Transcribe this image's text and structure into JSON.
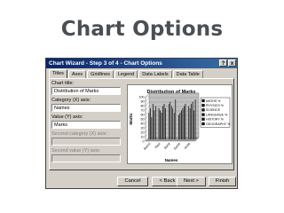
{
  "slide": {
    "title": "Chart Options"
  },
  "dialog": {
    "title": "Chart Wizard - Step 3 of 4 - Chart Options",
    "help_label": "?",
    "close_label": "x",
    "tabs": [
      "Titles",
      "Axes",
      "Gridlines",
      "Legend",
      "Data Labels",
      "Data Table"
    ],
    "active_tab": "Titles",
    "fields": {
      "chart_title": {
        "label": "Chart title:",
        "value": "Distribution of Marks"
      },
      "category_x": {
        "label": "Category (X) axis:",
        "value": "Names"
      },
      "value_y": {
        "label": "Value (Y) axis:",
        "value": "Marks"
      },
      "second_category_x": {
        "label": "Second category (X) axis:",
        "value": ""
      },
      "second_value_y": {
        "label": "Second value (Y) axis:",
        "value": ""
      }
    },
    "buttons": {
      "cancel": "Cancel",
      "back": "< Back",
      "next": "Next >",
      "finish": "Finish"
    }
  },
  "chart_data": {
    "type": "bar",
    "title": "Distribution of Marks",
    "xlabel": "Names",
    "ylabel": "Marks",
    "ylim": [
      0,
      100
    ],
    "yticks": [
      0,
      10,
      20,
      30,
      40,
      50,
      60,
      70,
      80,
      90,
      100
    ],
    "categories": [
      "Rahul",
      "Ravi",
      "Rohit",
      "Sonia",
      "Anita"
    ],
    "series": [
      {
        "name": "MATHS %",
        "values": [
          60,
          70,
          80,
          55,
          75
        ]
      },
      {
        "name": "PHYSICS %",
        "values": [
          70,
          65,
          85,
          60,
          70
        ]
      },
      {
        "name": "SCIENCE",
        "values": [
          50,
          60,
          75,
          65,
          80
        ]
      },
      {
        "name": "LANGUAGE %",
        "values": [
          80,
          75,
          70,
          70,
          85
        ]
      },
      {
        "name": "HISTORY %",
        "values": [
          65,
          80,
          60,
          75,
          65
        ]
      },
      {
        "name": "GEOGRAPHY %",
        "values": [
          75,
          70,
          90,
          80,
          90
        ]
      }
    ],
    "legend": "right"
  }
}
